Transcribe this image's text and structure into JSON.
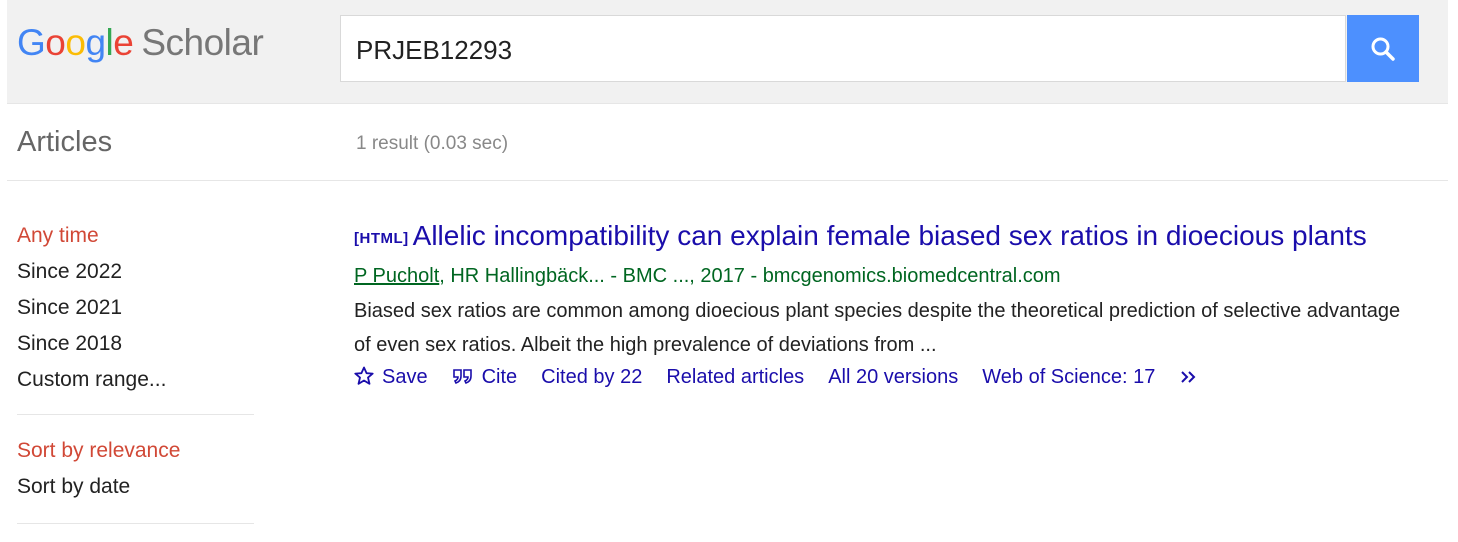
{
  "header": {
    "logo": {
      "g1": "G",
      "g2": "o",
      "g3": "o",
      "g4": "g",
      "g5": "l",
      "g6": "e",
      "scholar": "Scholar"
    },
    "search_value": "PRJEB12293",
    "search_icon": "search-icon",
    "accent_color": "#4d90fe"
  },
  "subbar": {
    "section_title": "Articles",
    "result_count": "1 result (0.03 sec)"
  },
  "sidebar": {
    "time_filters": [
      "Any time",
      "Since 2022",
      "Since 2021",
      "Since 2018",
      "Custom range..."
    ],
    "sort_options": [
      "Sort by relevance",
      "Sort by date"
    ]
  },
  "result": {
    "type_tag": "[HTML]",
    "title": "Allelic incompatibility can explain female biased sex ratios in dioecious plants",
    "first_author": "P Pucholt",
    "authors_rest": ", HR Hallingbäck... - BMC ..., 2017 - bmcgenomics.biomedcentral.com",
    "snippet": "Biased sex ratios are common among dioecious plant species despite the theoretical prediction of selective advantage of even sex ratios. Albeit the high prevalence of deviations from ...",
    "save_label": "Save",
    "cite_label": "Cite",
    "cited_by": "Cited by 22",
    "related": "Related articles",
    "versions": "All 20 versions",
    "wos": "Web of Science: 17"
  }
}
